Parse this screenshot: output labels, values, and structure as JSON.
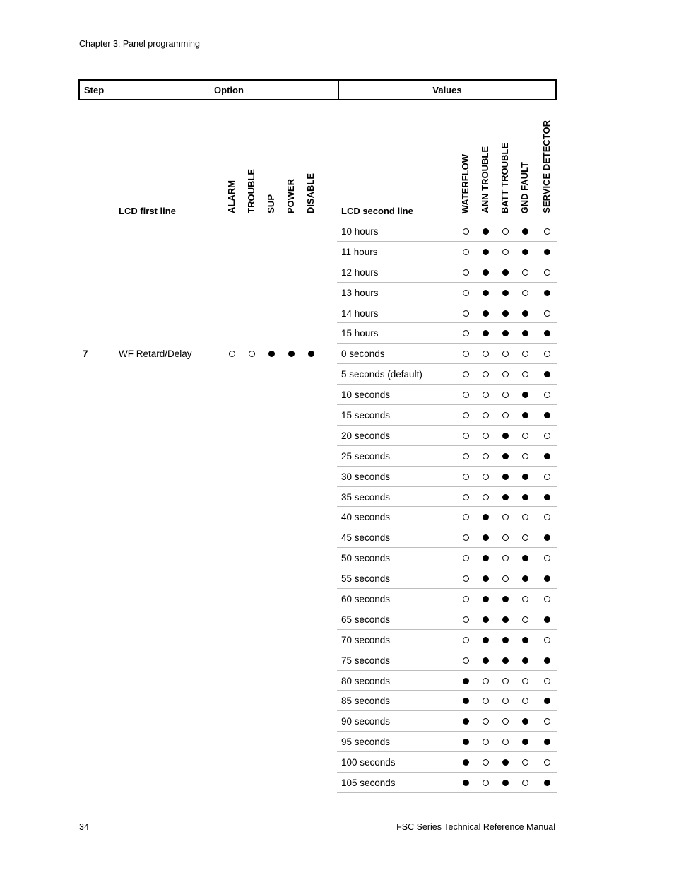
{
  "page": {
    "running_head": "Chapter 3: Panel programming",
    "page_number": "34",
    "footer_title": "FSC Series Technical Reference Manual"
  },
  "table": {
    "headers": {
      "step": "Step",
      "option": "Option",
      "values": "Values"
    },
    "lcd_first_line": "LCD first line",
    "lcd_second_line": "LCD second line",
    "option_columns": [
      "ALARM",
      "TROUBLE",
      "SUP",
      "POWER",
      "DISABLE"
    ],
    "value_columns": [
      "WATERFLOW",
      "ANN TROUBLE",
      "BATT TROUBLE",
      "GND FAULT",
      "SERVICE DETECTOR"
    ],
    "legend": {
      "filled": "on (●)",
      "hollow": "off (○)"
    },
    "rows": [
      {
        "step": "",
        "option": "",
        "option_pattern": null,
        "value": "10 hours",
        "pattern": [
          0,
          1,
          0,
          1,
          0
        ]
      },
      {
        "step": "",
        "option": "",
        "option_pattern": null,
        "value": "11 hours",
        "pattern": [
          0,
          1,
          0,
          1,
          1
        ]
      },
      {
        "step": "",
        "option": "",
        "option_pattern": null,
        "value": "12 hours",
        "pattern": [
          0,
          1,
          1,
          0,
          0
        ]
      },
      {
        "step": "",
        "option": "",
        "option_pattern": null,
        "value": "13 hours",
        "pattern": [
          0,
          1,
          1,
          0,
          1
        ]
      },
      {
        "step": "",
        "option": "",
        "option_pattern": null,
        "value": "14 hours",
        "pattern": [
          0,
          1,
          1,
          1,
          0
        ]
      },
      {
        "step": "",
        "option": "",
        "option_pattern": null,
        "value": "15 hours",
        "pattern": [
          0,
          1,
          1,
          1,
          1
        ]
      },
      {
        "step": "7",
        "option": "WF Retard/Delay",
        "option_pattern": [
          0,
          0,
          1,
          1,
          1
        ],
        "value": "0 seconds",
        "pattern": [
          0,
          0,
          0,
          0,
          0
        ]
      },
      {
        "step": "",
        "option": "",
        "option_pattern": null,
        "value": "5 seconds (default)",
        "pattern": [
          0,
          0,
          0,
          0,
          1
        ]
      },
      {
        "step": "",
        "option": "",
        "option_pattern": null,
        "value": "10 seconds",
        "pattern": [
          0,
          0,
          0,
          1,
          0
        ]
      },
      {
        "step": "",
        "option": "",
        "option_pattern": null,
        "value": "15 seconds",
        "pattern": [
          0,
          0,
          0,
          1,
          1
        ]
      },
      {
        "step": "",
        "option": "",
        "option_pattern": null,
        "value": "20 seconds",
        "pattern": [
          0,
          0,
          1,
          0,
          0
        ]
      },
      {
        "step": "",
        "option": "",
        "option_pattern": null,
        "value": "25 seconds",
        "pattern": [
          0,
          0,
          1,
          0,
          1
        ]
      },
      {
        "step": "",
        "option": "",
        "option_pattern": null,
        "value": "30 seconds",
        "pattern": [
          0,
          0,
          1,
          1,
          0
        ]
      },
      {
        "step": "",
        "option": "",
        "option_pattern": null,
        "value": "35 seconds",
        "pattern": [
          0,
          0,
          1,
          1,
          1
        ]
      },
      {
        "step": "",
        "option": "",
        "option_pattern": null,
        "value": "40 seconds",
        "pattern": [
          0,
          1,
          0,
          0,
          0
        ]
      },
      {
        "step": "",
        "option": "",
        "option_pattern": null,
        "value": "45 seconds",
        "pattern": [
          0,
          1,
          0,
          0,
          1
        ]
      },
      {
        "step": "",
        "option": "",
        "option_pattern": null,
        "value": "50 seconds",
        "pattern": [
          0,
          1,
          0,
          1,
          0
        ]
      },
      {
        "step": "",
        "option": "",
        "option_pattern": null,
        "value": "55 seconds",
        "pattern": [
          0,
          1,
          0,
          1,
          1
        ]
      },
      {
        "step": "",
        "option": "",
        "option_pattern": null,
        "value": "60 seconds",
        "pattern": [
          0,
          1,
          1,
          0,
          0
        ]
      },
      {
        "step": "",
        "option": "",
        "option_pattern": null,
        "value": "65 seconds",
        "pattern": [
          0,
          1,
          1,
          0,
          1
        ]
      },
      {
        "step": "",
        "option": "",
        "option_pattern": null,
        "value": "70 seconds",
        "pattern": [
          0,
          1,
          1,
          1,
          0
        ]
      },
      {
        "step": "",
        "option": "",
        "option_pattern": null,
        "value": "75 seconds",
        "pattern": [
          0,
          1,
          1,
          1,
          1
        ]
      },
      {
        "step": "",
        "option": "",
        "option_pattern": null,
        "value": "80 seconds",
        "pattern": [
          1,
          0,
          0,
          0,
          0
        ]
      },
      {
        "step": "",
        "option": "",
        "option_pattern": null,
        "value": "85 seconds",
        "pattern": [
          1,
          0,
          0,
          0,
          1
        ]
      },
      {
        "step": "",
        "option": "",
        "option_pattern": null,
        "value": "90 seconds",
        "pattern": [
          1,
          0,
          0,
          1,
          0
        ]
      },
      {
        "step": "",
        "option": "",
        "option_pattern": null,
        "value": "95 seconds",
        "pattern": [
          1,
          0,
          0,
          1,
          1
        ]
      },
      {
        "step": "",
        "option": "",
        "option_pattern": null,
        "value": "100 seconds",
        "pattern": [
          1,
          0,
          1,
          0,
          0
        ]
      },
      {
        "step": "",
        "option": "",
        "option_pattern": null,
        "value": "105 seconds",
        "pattern": [
          1,
          0,
          1,
          0,
          1
        ]
      }
    ]
  }
}
